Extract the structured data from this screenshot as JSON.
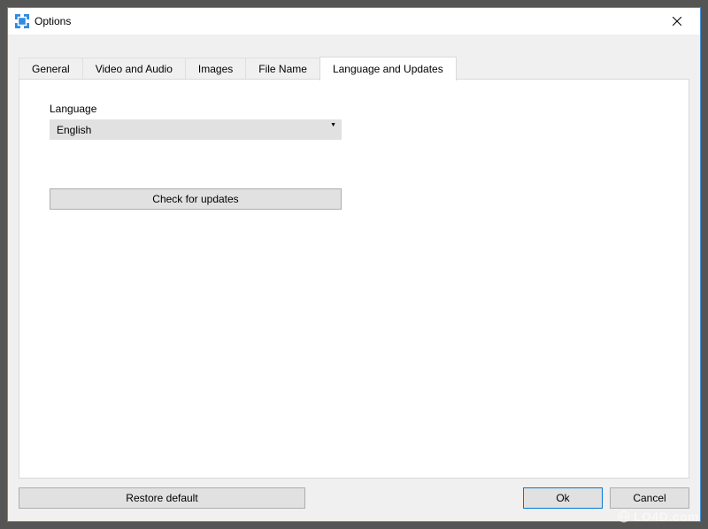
{
  "window": {
    "title": "Options"
  },
  "tabs": [
    {
      "label": "General"
    },
    {
      "label": "Video and Audio"
    },
    {
      "label": "Images"
    },
    {
      "label": "File Name"
    },
    {
      "label": "Language and Updates"
    }
  ],
  "language": {
    "label": "Language",
    "value": "English"
  },
  "buttons": {
    "check_updates": "Check for updates",
    "restore_default": "Restore default",
    "ok": "Ok",
    "cancel": "Cancel"
  },
  "watermark": "LO4D.com"
}
